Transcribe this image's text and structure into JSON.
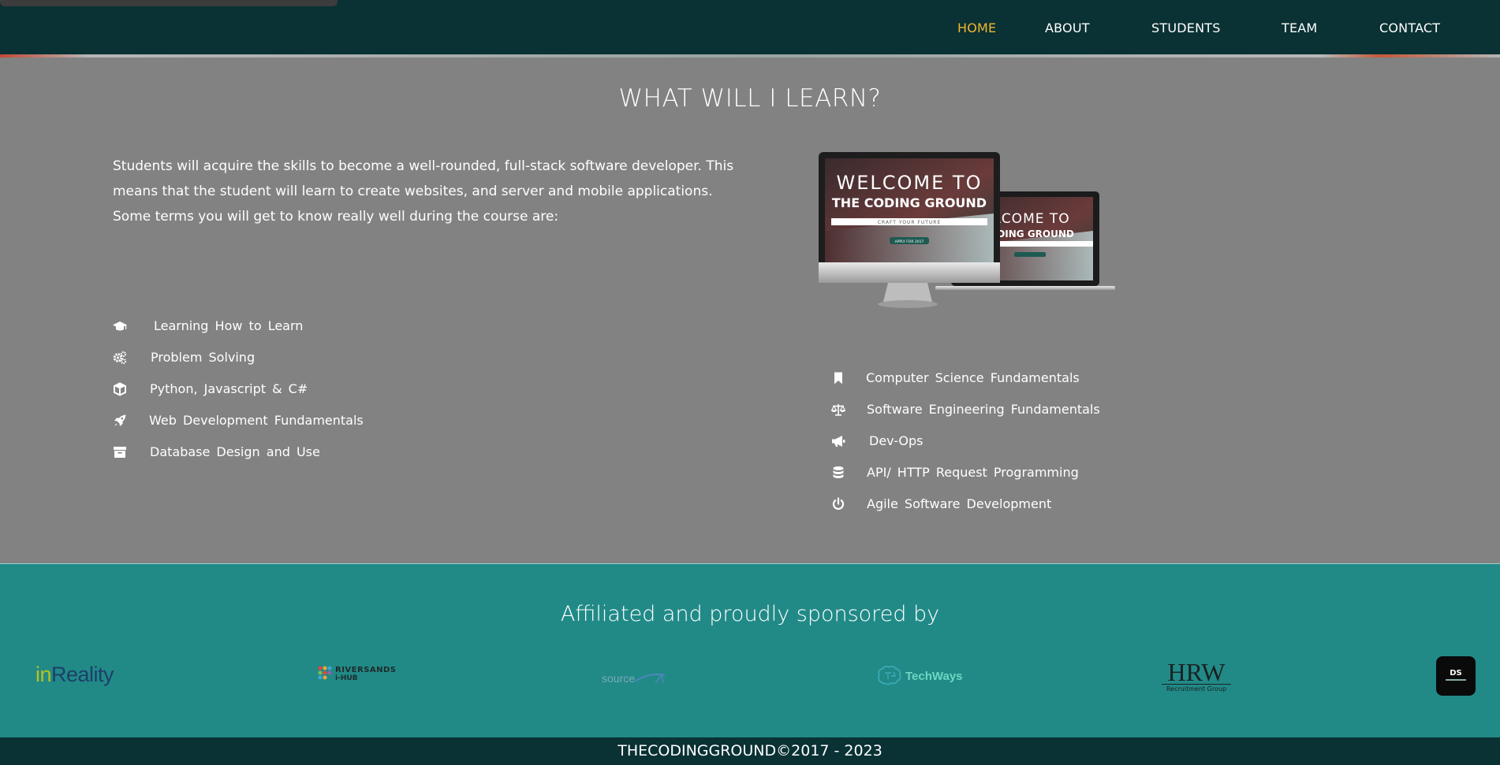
{
  "nav": {
    "items": [
      {
        "label": "HOME",
        "active": true
      },
      {
        "label": "ABOUT"
      },
      {
        "label": "STUDENTS"
      },
      {
        "label": "TEAM"
      },
      {
        "label": "CONTACT"
      }
    ]
  },
  "learn": {
    "title": "WHAT WILL I LEARN?",
    "intro": "Students will acquire the skills to become a well-rounded, full-stack software developer. This means that the student will learn to create websites, and server and mobile applications. Some terms you will get to know really well during the course are:",
    "left_items": [
      {
        "icon": "graduation-cap-icon",
        "label": "Learning How to Learn"
      },
      {
        "icon": "cogs-icon",
        "label": "Problem Solving"
      },
      {
        "icon": "cube-icon",
        "label": "Python, Javascript & C#"
      },
      {
        "icon": "rocket-icon",
        "label": "Web Development Fundamentals"
      },
      {
        "icon": "archive-icon",
        "label": "Database Design and Use"
      }
    ],
    "right_items": [
      {
        "icon": "bookmark-icon",
        "label": "Computer Science Fundamentals"
      },
      {
        "icon": "balance-scale-icon",
        "label": "Software Engineering Fundamentals"
      },
      {
        "icon": "bullhorn-icon",
        "label": "Dev-Ops"
      },
      {
        "icon": "database-icon",
        "label": "API/ HTTP Request Programming"
      },
      {
        "icon": "power-icon",
        "label": "Agile Software Development"
      }
    ],
    "device_image": {
      "line1": "WELCOME TO",
      "line2": "THE CODING GROUND",
      "tagline": "CRAFT YOUR FUTURE",
      "button": "APPLY FOR 2017",
      "laptop_line1": "LCOME TO",
      "laptop_line2": "ODING GROUND"
    }
  },
  "sponsors": {
    "title": "Affiliated and proudly sponsored by",
    "logos": [
      {
        "name": "inReality",
        "text_a": "in",
        "text_b": "Reality"
      },
      {
        "name": "Riversands iHub",
        "text_a": "RIVERSANDS",
        "text_b": "i-HUB"
      },
      {
        "name": "Source",
        "text_a": "source"
      },
      {
        "name": "TechWays",
        "text_a": "TechWays"
      },
      {
        "name": "HRW",
        "text_a": "HRW",
        "text_b": "Recruitment Group"
      },
      {
        "name": "DS",
        "text_a": "DS"
      }
    ]
  },
  "footer": {
    "text": "THECODINGGROUND©2017 - 2023"
  },
  "colors": {
    "nav_bg": "#0a3133",
    "nav_active": "#f2b632",
    "learn_bg": "#828282",
    "sponsors_bg": "#218a87"
  }
}
